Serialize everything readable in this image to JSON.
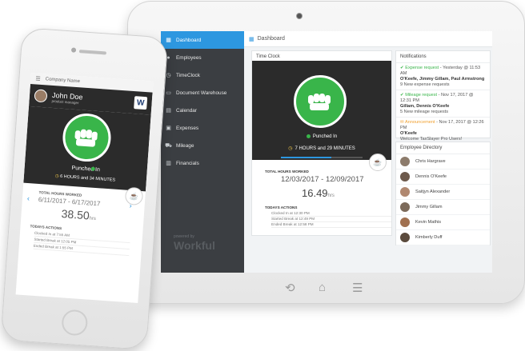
{
  "colors": {
    "accent": "#2d97e0",
    "punch_green": "#39b54a",
    "sidebar": "#3b3e42",
    "dark_panel": "#2b2b2b"
  },
  "tablet": {
    "header_title": "Dashboard",
    "sidebar": {
      "items": [
        {
          "label": "Dashboard",
          "icon": "dashboard-icon",
          "active": true
        },
        {
          "label": "Employees",
          "icon": "users-icon",
          "active": false
        },
        {
          "label": "TimeClock",
          "icon": "clock-icon",
          "active": false
        },
        {
          "label": "Document Warehouse",
          "icon": "document-icon",
          "active": false
        },
        {
          "label": "Calendar",
          "icon": "calendar-icon",
          "active": false
        },
        {
          "label": "Expenses",
          "icon": "expenses-icon",
          "active": false
        },
        {
          "label": "Mileage",
          "icon": "car-icon",
          "active": false
        },
        {
          "label": "Financials",
          "icon": "financials-icon",
          "active": false
        }
      ],
      "brand_small": "powered by",
      "brand": "Workful"
    },
    "time_clock": {
      "title": "Time Clock",
      "status": "Punched In",
      "duration": "7 HOURS and 29 MINUTES",
      "progress": 0.62,
      "total_label": "TOTAL HOURS WORKED",
      "range": "12/03/2017 - 12/09/2017",
      "hours_value": "16.49",
      "hours_unit": "hrs",
      "actions_label": "TODAYS ACTIONS",
      "actions": [
        "Clocked In at 12:30 PM",
        "Started Break at 12:49 PM",
        "Ended Break at 12:58 PM"
      ]
    },
    "notifications": {
      "title": "Notifications",
      "items": [
        {
          "type": "Expense request",
          "date": " - Yesterday @ 11:53 AM",
          "names": "O'Keefe, Jimmy Gillam, Paul Armstrong",
          "detail": "9 New expense requests",
          "warn": false
        },
        {
          "type": "Mileage request",
          "date": " - Nov 17, 2017 @ 12:31 PM",
          "names": "Gillam, Dennis O'Keefe",
          "detail": "5 New mileage requests",
          "warn": false
        },
        {
          "type": "Announcement",
          "date": " - Nov 17, 2017 @ 12:26 PM",
          "names": "O'Keefe",
          "detail": "Welcome TaxSlayer Pro Users!",
          "warn": true
        }
      ]
    },
    "directory": {
      "title": "Employee Directory",
      "employees": [
        "Chris Hargrave",
        "Dennis O'Keefe",
        "Saitjyn Alexander",
        "Jimmy Gillam",
        "Kevin Mathis",
        "Kimberly Duff"
      ]
    },
    "nav_buttons": {
      "back": "⟲",
      "home": "⌂",
      "menu": "☰"
    }
  },
  "phone": {
    "company": "Company Name",
    "user_name": "John Doe",
    "user_role": "product manager",
    "logo": "W",
    "status": "Punched In",
    "duration": "6 HOURS and 34 MINUTES",
    "total_label": "TOTAL HOURS WORKED",
    "range": "6/11/2017 - 6/17/2017",
    "hours_value": "38.50",
    "hours_unit": "hrs",
    "actions_label": "TODAYS ACTIONS",
    "actions": [
      "Clocked In at 7:55 AM",
      "Started Break at 12:05 PM",
      "Ended Break at 1:55 PM"
    ]
  }
}
